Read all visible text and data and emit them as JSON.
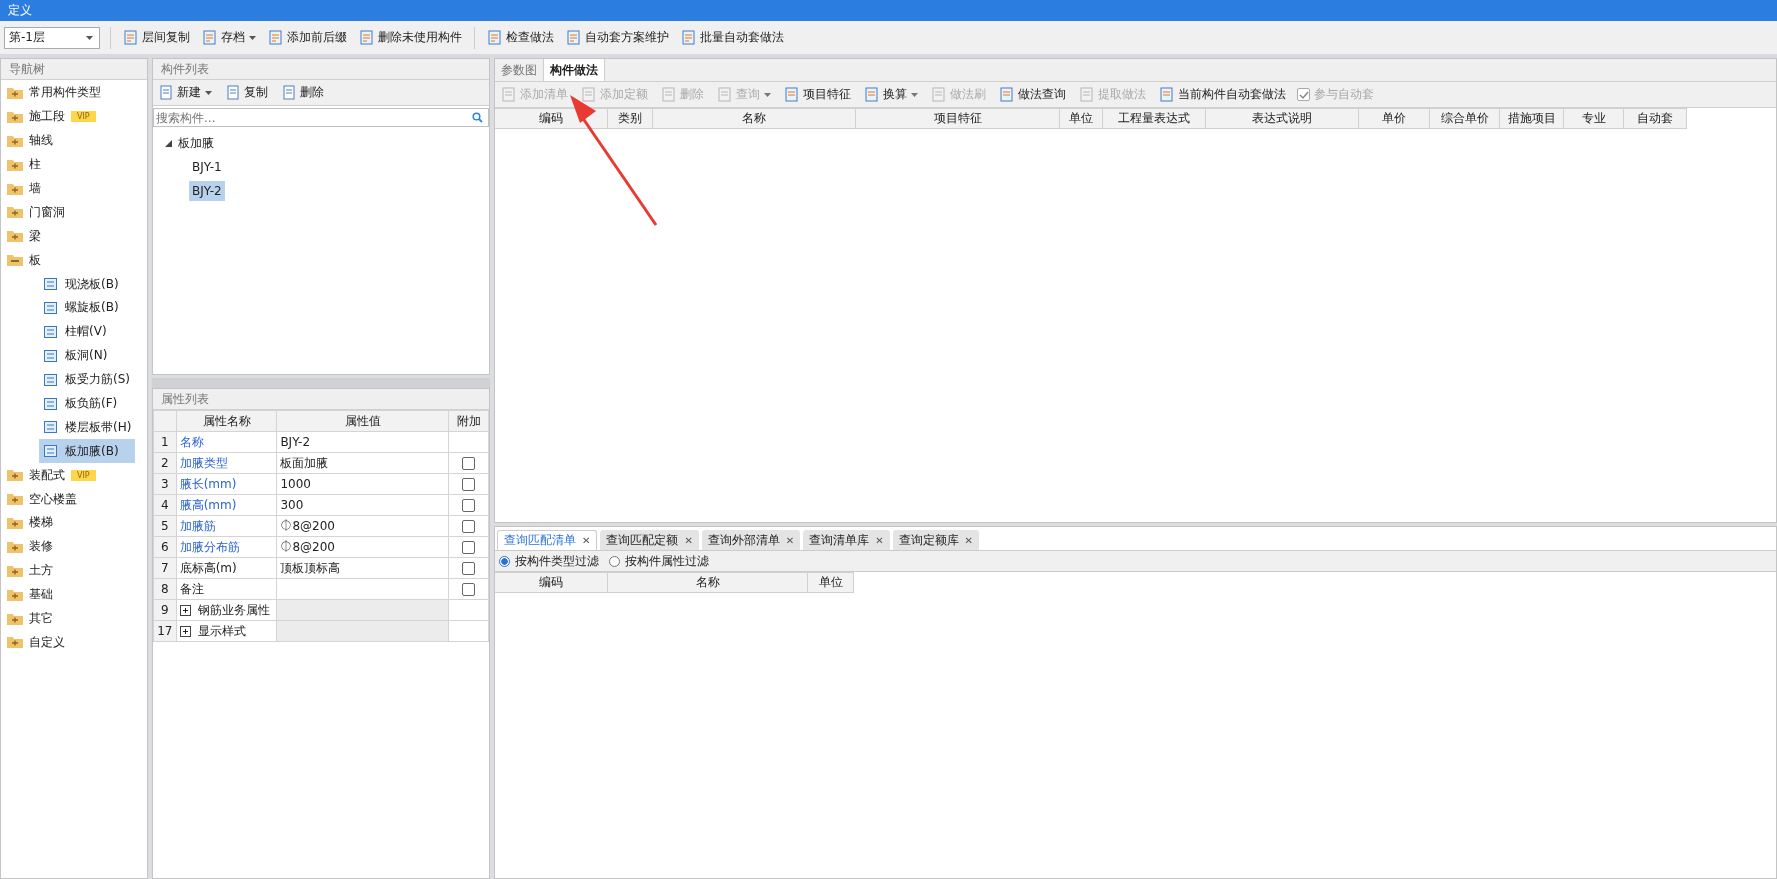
{
  "window": {
    "title": "定义"
  },
  "toolbar": {
    "floor_select": "第-1层",
    "groups": [
      [
        {
          "label": "层间复制",
          "dropdown": false
        },
        {
          "label": "存档",
          "dropdown": true
        },
        {
          "label": "添加前后缀",
          "dropdown": false
        },
        {
          "label": "删除未使用构件",
          "dropdown": false
        }
      ],
      [
        {
          "label": "检查做法",
          "dropdown": false
        },
        {
          "label": "自动套方案维护",
          "dropdown": false
        },
        {
          "label": "批量自动套做法",
          "dropdown": false
        }
      ]
    ]
  },
  "nav": {
    "title": "导航树",
    "items": [
      {
        "label": "常用构件类型",
        "selected": false
      },
      {
        "label": "施工段",
        "badge": "VIP",
        "selected": false
      },
      {
        "label": "轴线",
        "selected": false
      },
      {
        "label": "柱",
        "selected": false
      },
      {
        "label": "墙",
        "selected": false
      },
      {
        "label": "门窗洞",
        "selected": false
      },
      {
        "label": "梁",
        "selected": false
      },
      {
        "label": "板",
        "selected": false,
        "expanded": true,
        "children": [
          {
            "label": "现浇板(B)",
            "selected": false
          },
          {
            "label": "螺旋板(B)",
            "selected": false
          },
          {
            "label": "柱帽(V)",
            "selected": false
          },
          {
            "label": "板洞(N)",
            "selected": false
          },
          {
            "label": "板受力筋(S)",
            "selected": false
          },
          {
            "label": "板负筋(F)",
            "selected": false
          },
          {
            "label": "楼层板带(H)",
            "selected": false
          },
          {
            "label": "板加腋(B)",
            "selected": true
          }
        ]
      },
      {
        "label": "装配式",
        "badge": "VIP",
        "selected": false
      },
      {
        "label": "空心楼盖",
        "selected": false
      },
      {
        "label": "楼梯",
        "selected": false
      },
      {
        "label": "装修",
        "selected": false
      },
      {
        "label": "土方",
        "selected": false
      },
      {
        "label": "基础",
        "selected": false
      },
      {
        "label": "其它",
        "selected": false
      },
      {
        "label": "自定义",
        "selected": false
      }
    ]
  },
  "component_list": {
    "title": "构件列表",
    "buttons": [
      {
        "label": "新建",
        "dropdown": true
      },
      {
        "label": "复制",
        "dropdown": false
      },
      {
        "label": "删除",
        "dropdown": false
      }
    ],
    "search": {
      "placeholder": "搜索构件..."
    },
    "tree": [
      {
        "label": "板加腋",
        "expanded": true,
        "children": [
          {
            "label": "BJY-1",
            "selected": false
          },
          {
            "label": "BJY-2",
            "selected": true
          }
        ]
      }
    ]
  },
  "properties": {
    "title": "属性列表",
    "columns": [
      "属性名称",
      "属性值",
      "附加"
    ],
    "rows": [
      {
        "num": "1",
        "kind": "public",
        "name": "名称",
        "value": "BJY-2"
      },
      {
        "num": "2",
        "kind": "public",
        "name": "加腋类型",
        "value": "板面加腋",
        "checked": false
      },
      {
        "num": "3",
        "kind": "public",
        "name": "腋长(mm)",
        "value": "1000",
        "checked": false
      },
      {
        "num": "4",
        "kind": "public",
        "name": "腋高(mm)",
        "value": "300",
        "checked": false
      },
      {
        "num": "5",
        "kind": "public",
        "name": "加腋筋",
        "value": "⏀8@200",
        "checked": false
      },
      {
        "num": "6",
        "kind": "public",
        "name": "加腋分布筋",
        "value": "⏀8@200",
        "checked": false
      },
      {
        "num": "7",
        "kind": "private",
        "name": "底标高(m)",
        "value": "顶板顶标高",
        "checked": false
      },
      {
        "num": "8",
        "kind": "private",
        "name": "备注",
        "value": "",
        "checked": false
      },
      {
        "num": "9",
        "kind": "group",
        "name": "钢筋业务属性",
        "expanded": false
      },
      {
        "num": "17",
        "kind": "group",
        "name": "显示样式",
        "expanded": false
      }
    ]
  },
  "detail": {
    "tabs": [
      {
        "label": "参数图",
        "selected": false
      },
      {
        "label": "构件做法",
        "selected": true
      }
    ],
    "toolbar": [
      {
        "label": "添加清单",
        "disabled": true,
        "dropdown": false
      },
      {
        "label": "添加定额",
        "disabled": true,
        "dropdown": false
      },
      {
        "label": "删除",
        "disabled": true,
        "dropdown": false
      },
      {
        "label": "查询",
        "disabled": true,
        "dropdown": true
      },
      {
        "label": "项目特征",
        "disabled": false,
        "dropdown": false
      },
      {
        "label": "换算",
        "disabled": false,
        "dropdown": true
      },
      {
        "label": "做法刷",
        "disabled": true,
        "dropdown": false
      },
      {
        "label": "做法查询",
        "disabled": false,
        "dropdown": false
      },
      {
        "label": "提取做法",
        "disabled": true,
        "dropdown": false
      },
      {
        "label": "当前构件自动套做法",
        "disabled": false,
        "dropdown": false
      }
    ],
    "auto_checkbox": {
      "label": "参与自动套",
      "checked": true,
      "disabled": true
    },
    "columns": [
      "编码",
      "类别",
      "名称",
      "项目特征",
      "单位",
      "工程量表达式",
      "表达式说明",
      "单价",
      "综合单价",
      "措施项目",
      "专业",
      "自动套"
    ]
  },
  "query": {
    "tabs": [
      {
        "label": "查询匹配清单",
        "selected": true,
        "close": "✕"
      },
      {
        "label": "查询匹配定额",
        "selected": false,
        "close": "✕"
      },
      {
        "label": "查询外部清单",
        "selected": false,
        "close": "✕"
      },
      {
        "label": "查询清单库",
        "selected": false,
        "close": "✕"
      },
      {
        "label": "查询定额库",
        "selected": false,
        "close": "✕"
      }
    ],
    "filters": [
      {
        "label": "按构件类型过滤",
        "selected": true
      },
      {
        "label": "按构件属性过滤",
        "selected": false
      }
    ],
    "columns": [
      "编码",
      "名称",
      "单位"
    ]
  }
}
